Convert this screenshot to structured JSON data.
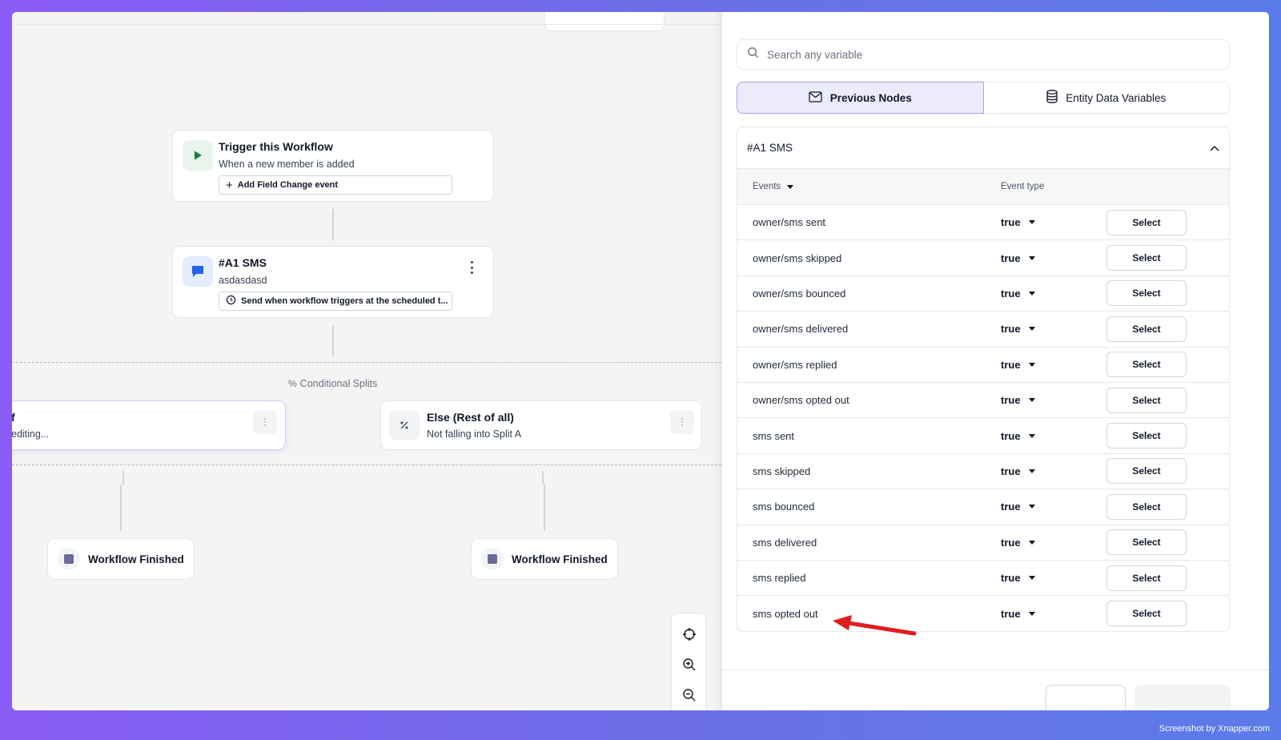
{
  "canvas": {
    "trigger": {
      "title": "Trigger this Workflow",
      "subtitle": "When a new member is added",
      "chip": "Add Field Change event"
    },
    "sms_node": {
      "title": "#A1 SMS",
      "subtitle": "asdasdasd",
      "chip": "Send when workflow triggers at the scheduled t..."
    },
    "splits_label": "Conditional Splits",
    "split_a": {
      "title": "f",
      "subtitle": "editing..."
    },
    "split_else": {
      "title": "Else (Rest of all)",
      "subtitle": "Not falling into Split A"
    },
    "finished_left": "Workflow Finished",
    "finished_right": "Workflow Finished"
  },
  "panel": {
    "search": {
      "placeholder": "Search any variable",
      "value": ""
    },
    "tabs": [
      {
        "label": "Previous Nodes",
        "icon": "mail-icon",
        "active": true
      },
      {
        "label": "Entity Data Variables",
        "icon": "database-icon",
        "active": false
      }
    ],
    "accordion": {
      "title": "#A1 SMS",
      "expanded": true,
      "columns": {
        "events": "Events",
        "event_type": "Event type"
      },
      "rows": [
        {
          "event": "owner/sms sent",
          "type": "true",
          "action": "Select"
        },
        {
          "event": "owner/sms skipped",
          "type": "true",
          "action": "Select"
        },
        {
          "event": "owner/sms bounced",
          "type": "true",
          "action": "Select"
        },
        {
          "event": "owner/sms delivered",
          "type": "true",
          "action": "Select"
        },
        {
          "event": "owner/sms replied",
          "type": "true",
          "action": "Select"
        },
        {
          "event": "owner/sms opted out",
          "type": "true",
          "action": "Select"
        },
        {
          "event": "sms sent",
          "type": "true",
          "action": "Select"
        },
        {
          "event": "sms skipped",
          "type": "true",
          "action": "Select"
        },
        {
          "event": "sms bounced",
          "type": "true",
          "action": "Select"
        },
        {
          "event": "sms delivered",
          "type": "true",
          "action": "Select"
        },
        {
          "event": "sms replied",
          "type": "true",
          "action": "Select"
        },
        {
          "event": "sms opted out",
          "type": "true",
          "action": "Select"
        }
      ]
    }
  },
  "colors": {
    "accent": "#a5a3e6",
    "trigger_icon": "#15803d",
    "sms_icon": "#2563eb",
    "annotation_arrow": "#e11d1d"
  },
  "watermark": "Screenshot by Xnapper.com"
}
